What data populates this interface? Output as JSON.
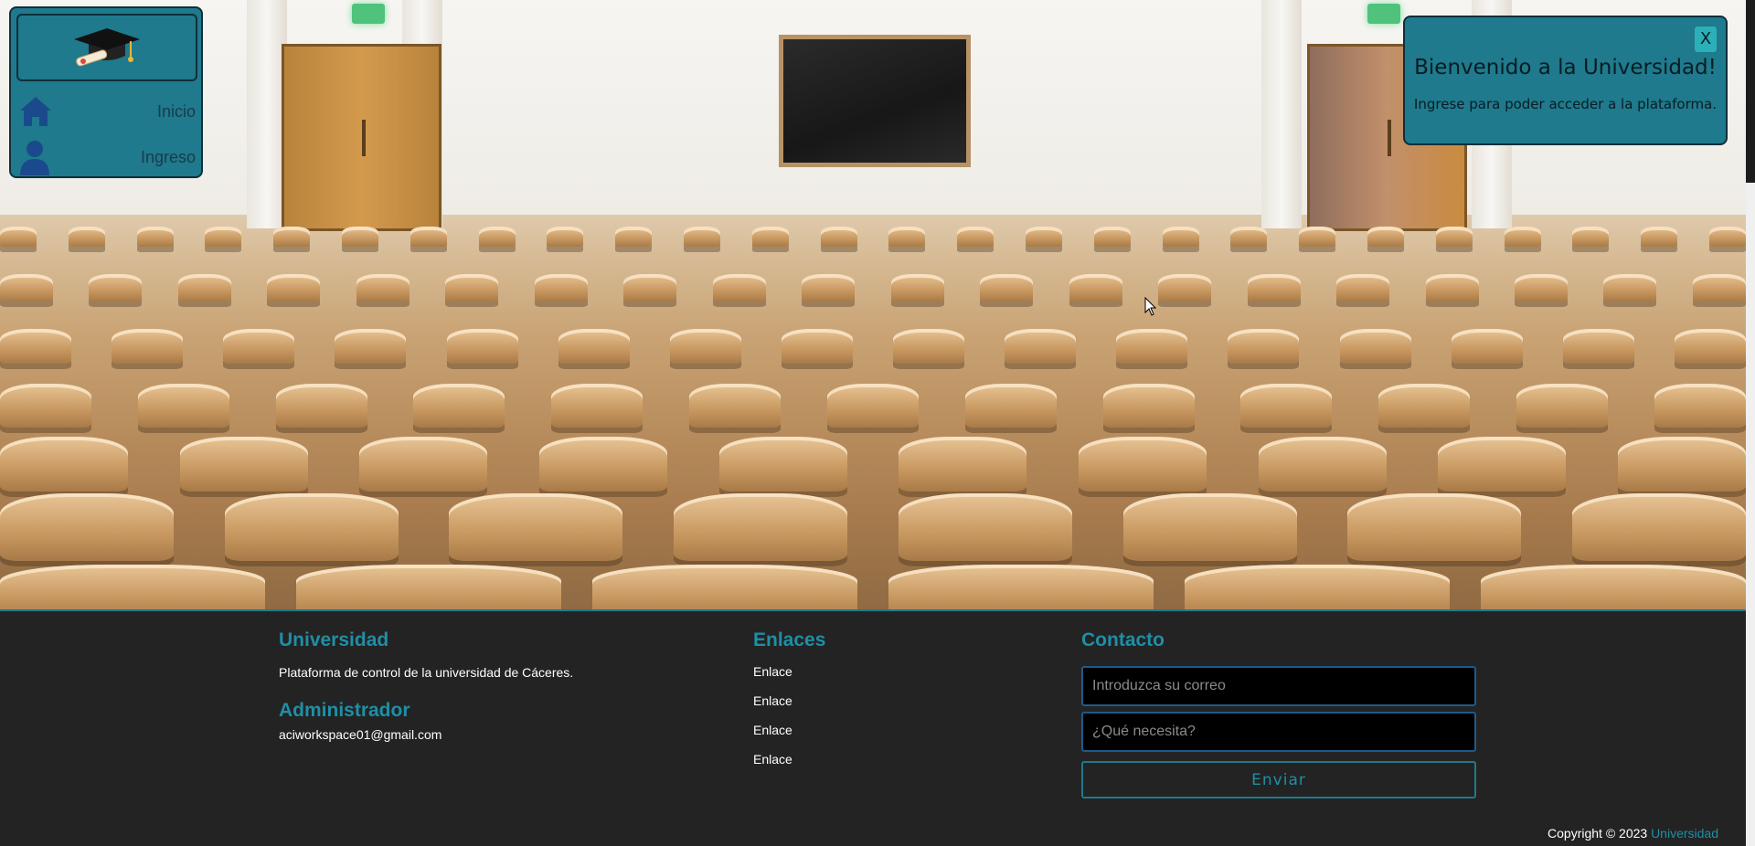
{
  "nav": {
    "logo_icon": "graduation-cap-icon",
    "items": [
      {
        "label": "Inicio",
        "icon": "house-icon"
      },
      {
        "label": "Ingreso",
        "icon": "user-icon"
      }
    ]
  },
  "toast": {
    "close_label": "X",
    "title": "Bienvenido a la Universidad!",
    "message": "Ingrese para poder acceder a la plataforma."
  },
  "footer": {
    "university": {
      "heading": "Universidad",
      "description": "Plataforma de control de la universidad de Cáceres."
    },
    "admin": {
      "heading": "Administrador",
      "email": "aciworkspace01@gmail.com"
    },
    "links": {
      "heading": "Enlaces",
      "items": [
        "Enlace",
        "Enlace",
        "Enlace",
        "Enlace"
      ]
    },
    "contact": {
      "heading": "Contacto",
      "email_placeholder": "Introduzca su correo",
      "need_placeholder": "¿Qué necesita?",
      "send_label": "Enviar"
    },
    "copyright_prefix": "Copyright © 2023",
    "copyright_brand": "Universidad"
  },
  "colors": {
    "accent": "#1e7a8c",
    "link_accent": "#1e8fa6",
    "footer_bg": "#232323"
  }
}
